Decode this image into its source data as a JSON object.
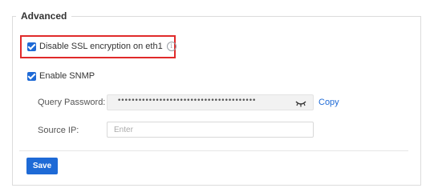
{
  "section": {
    "title": "Advanced"
  },
  "ssl": {
    "label": "Disable SSL encryption on eth1",
    "checked": true,
    "info_icon": "info-icon",
    "info_glyph": "i",
    "highlight_color": "#e02a2a"
  },
  "snmp": {
    "label": "Enable SNMP",
    "checked": true,
    "query_password": {
      "label": "Query Password:",
      "masked_value": "••••••••••••••••••••••••••••••••••••••••",
      "toggle_icon": "eye-closed-icon",
      "copy_label": "Copy"
    },
    "source_ip": {
      "label": "Source IP:",
      "value": "",
      "placeholder": "Enter"
    }
  },
  "actions": {
    "save_label": "Save"
  },
  "colors": {
    "accent": "#1e6ad6",
    "highlight": "#e02a2a"
  }
}
